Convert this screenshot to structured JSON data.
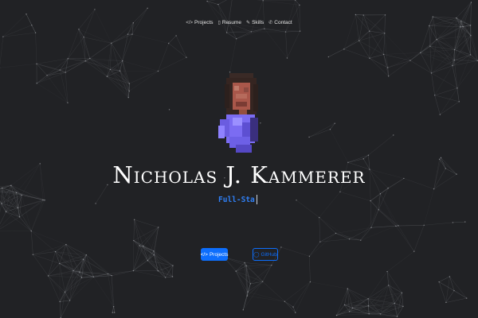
{
  "nav": {
    "items": [
      {
        "icon": "code-icon",
        "glyph": "</>",
        "label": "Projects"
      },
      {
        "icon": "document-icon",
        "glyph": "▯",
        "label": "Resume"
      },
      {
        "icon": "wrench-icon",
        "glyph": "✎",
        "label": "Skills"
      },
      {
        "icon": "phone-icon",
        "glyph": "✆",
        "label": "Contact"
      }
    ]
  },
  "hero": {
    "name": "Nicholas J. Kammerer",
    "typed_subtitle": "Full-Sta"
  },
  "buttons": {
    "projects": {
      "icon": "code-icon",
      "glyph": "</>",
      "label": "Projects"
    },
    "github": {
      "icon": "github-icon",
      "glyph": "◯",
      "label": "GitHub"
    }
  },
  "colors": {
    "background": "#212225",
    "accent": "#0d6efd",
    "subtitle": "#2f7ff5",
    "network_lines": "#8a8d92",
    "avatar_shirt": "#7b6cf2"
  }
}
